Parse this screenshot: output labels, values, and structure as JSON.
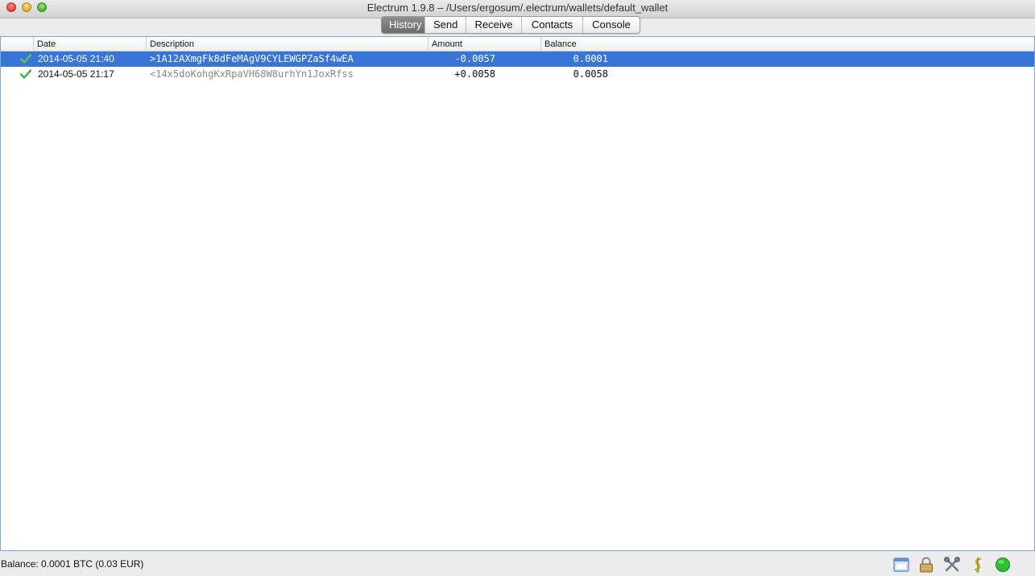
{
  "window": {
    "title": "Electrum 1.9.8  –  /Users/ergosum/.electrum/wallets/default_wallet"
  },
  "tabs": [
    {
      "label": "History",
      "active": true
    },
    {
      "label": "Send",
      "active": false
    },
    {
      "label": "Receive",
      "active": false
    },
    {
      "label": "Contacts",
      "active": false
    },
    {
      "label": "Console",
      "active": false
    }
  ],
  "history": {
    "columns": [
      "",
      "Date",
      "Description",
      "Amount",
      "Balance"
    ],
    "rows": [
      {
        "status_icon": "confirmed-check-icon",
        "date": "2014-05-05 21:40",
        "description": ">1A12AXmgFk8dFeMAgV9CYLEWGPZaSf4wEA",
        "amount": "-0.0057",
        "balance": "0.0001",
        "selected": true
      },
      {
        "status_icon": "confirmed-check-icon",
        "date": "2014-05-05 21:17",
        "description": "<14x5doKohgKxRpaVH68W8urhYn1JoxRfss",
        "amount": "+0.0058",
        "balance": "0.0058",
        "selected": false
      }
    ]
  },
  "statusbar": {
    "balance_text": "Balance: 0.0001 BTC  (0.03 EUR)",
    "icons": [
      "preferences-icon",
      "lock-icon",
      "tools-icon",
      "seed-icon",
      "network-status-icon"
    ]
  },
  "colors": {
    "selection": "#3875d7",
    "check": "#4caf50",
    "network_ok": "#2fbf2f"
  }
}
